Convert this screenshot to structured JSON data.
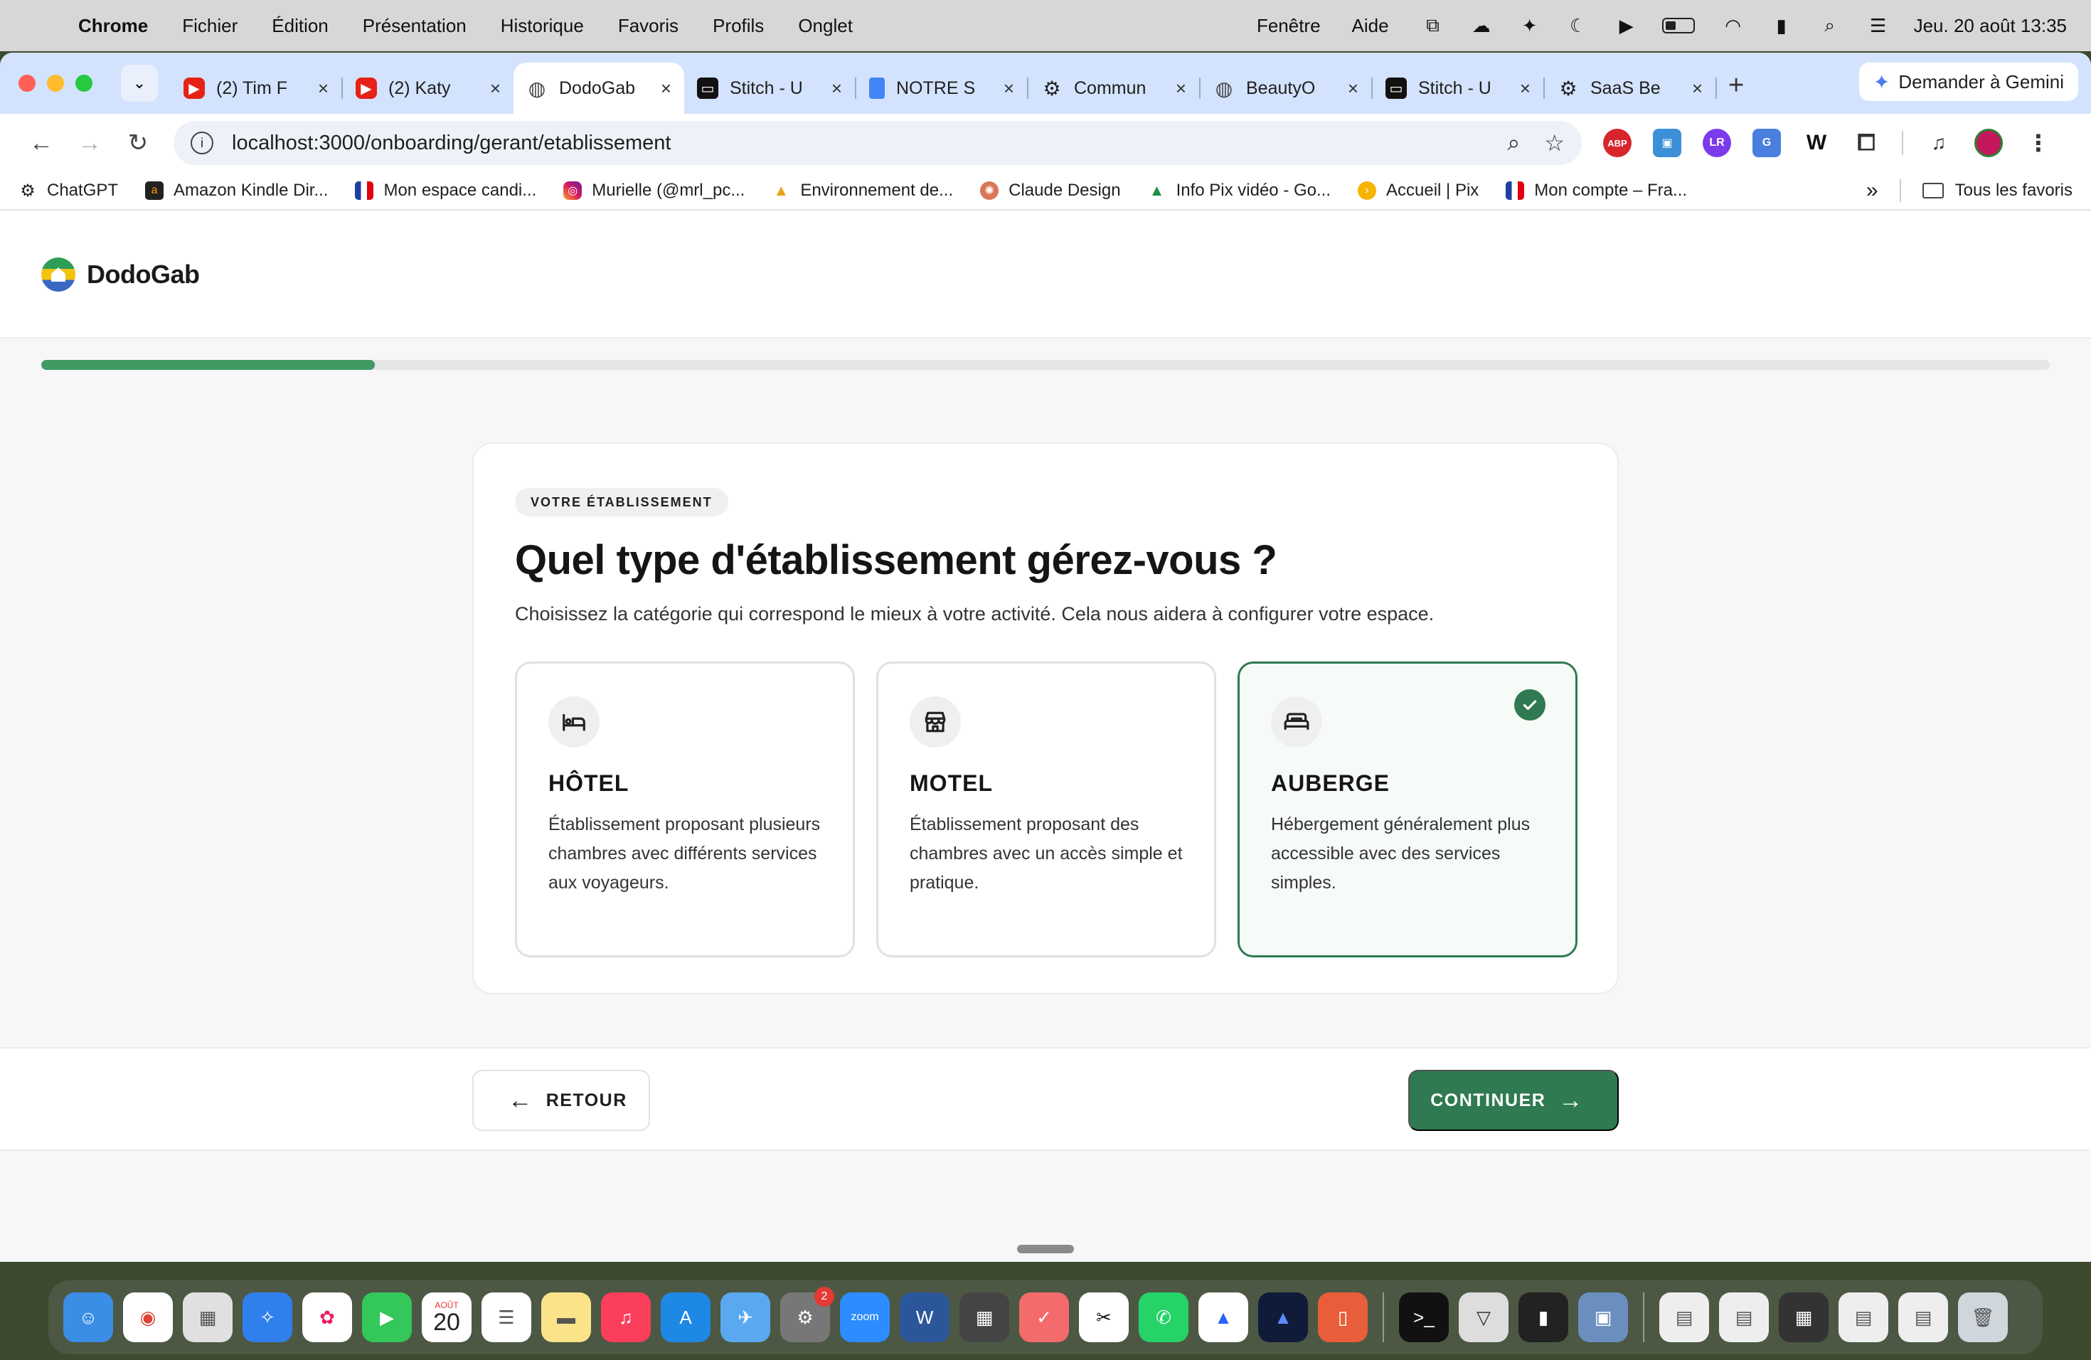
{
  "menubar": {
    "app": "Chrome",
    "items": [
      "Fichier",
      "Édition",
      "Présentation",
      "Historique",
      "Favoris",
      "Profils",
      "Onglet"
    ],
    "right_items": [
      "Fenêtre",
      "Aide"
    ],
    "clock": "Jeu. 20 août  13:35"
  },
  "browser": {
    "tabs": [
      {
        "title": "(2) Tim F",
        "icon": "youtube-icon"
      },
      {
        "title": "(2) Katy",
        "icon": "youtube-icon"
      },
      {
        "title": "DodoGab",
        "icon": "globe-icon",
        "active": true
      },
      {
        "title": "Stitch - U",
        "icon": "stitch-icon"
      },
      {
        "title": "NOTRE S",
        "icon": "docs-icon"
      },
      {
        "title": "Commun",
        "icon": "chatgpt-icon"
      },
      {
        "title": "BeautyO",
        "icon": "globe-icon"
      },
      {
        "title": "Stitch - U",
        "icon": "stitch-icon"
      },
      {
        "title": "SaaS Be",
        "icon": "chatgpt-icon"
      }
    ],
    "gemini_label": "Demander à Gemini",
    "url": "localhost:3000/onboarding/gerant/etablissement",
    "bookmarks": [
      {
        "label": "ChatGPT",
        "icon": "gpt"
      },
      {
        "label": "Amazon Kindle Dir...",
        "icon": "amz"
      },
      {
        "label": "Mon espace candi...",
        "icon": "fr"
      },
      {
        "label": "Murielle (@mrl_pc...",
        "icon": "ig"
      },
      {
        "label": "Environnement de...",
        "icon": "env"
      },
      {
        "label": "Claude Design",
        "icon": "claude"
      },
      {
        "label": "Info Pix vidéo - Go...",
        "icon": "drive"
      },
      {
        "label": "Accueil | Pix",
        "icon": "pix"
      },
      {
        "label": "Mon compte – Fra...",
        "icon": "mc"
      }
    ],
    "all_bookmarks_label": "Tous les favoris"
  },
  "app": {
    "brand": "DodoGab",
    "progress_fraction": 0.166
  },
  "step": {
    "badge": "VOTRE ÉTABLISSEMENT",
    "question": "Quel type d'établissement gérez-vous ?",
    "subtitle": "Choisissez la catégorie qui correspond le mieux à votre activité. Cela nous aidera à configurer votre espace.",
    "options": [
      {
        "title": "HÔTEL",
        "description": "Établissement proposant plusieurs chambres avec différents services aux voyageurs.",
        "icon": "bed-icon",
        "selected": false
      },
      {
        "title": "MOTEL",
        "description": "Établissement proposant des chambres avec un accès simple et pratique.",
        "icon": "store-icon",
        "selected": false
      },
      {
        "title": "AUBERGE",
        "description": "Hébergement généralement plus accessible avec des services simples.",
        "icon": "hostel-bed-icon",
        "selected": true
      }
    ]
  },
  "actions": {
    "back_label": "RETOUR",
    "continue_label": "CONTINUER"
  },
  "dock": {
    "calendar_month": "AOÛT",
    "calendar_day": "20",
    "settings_badge": "2",
    "zoom_label": "zoom"
  }
}
